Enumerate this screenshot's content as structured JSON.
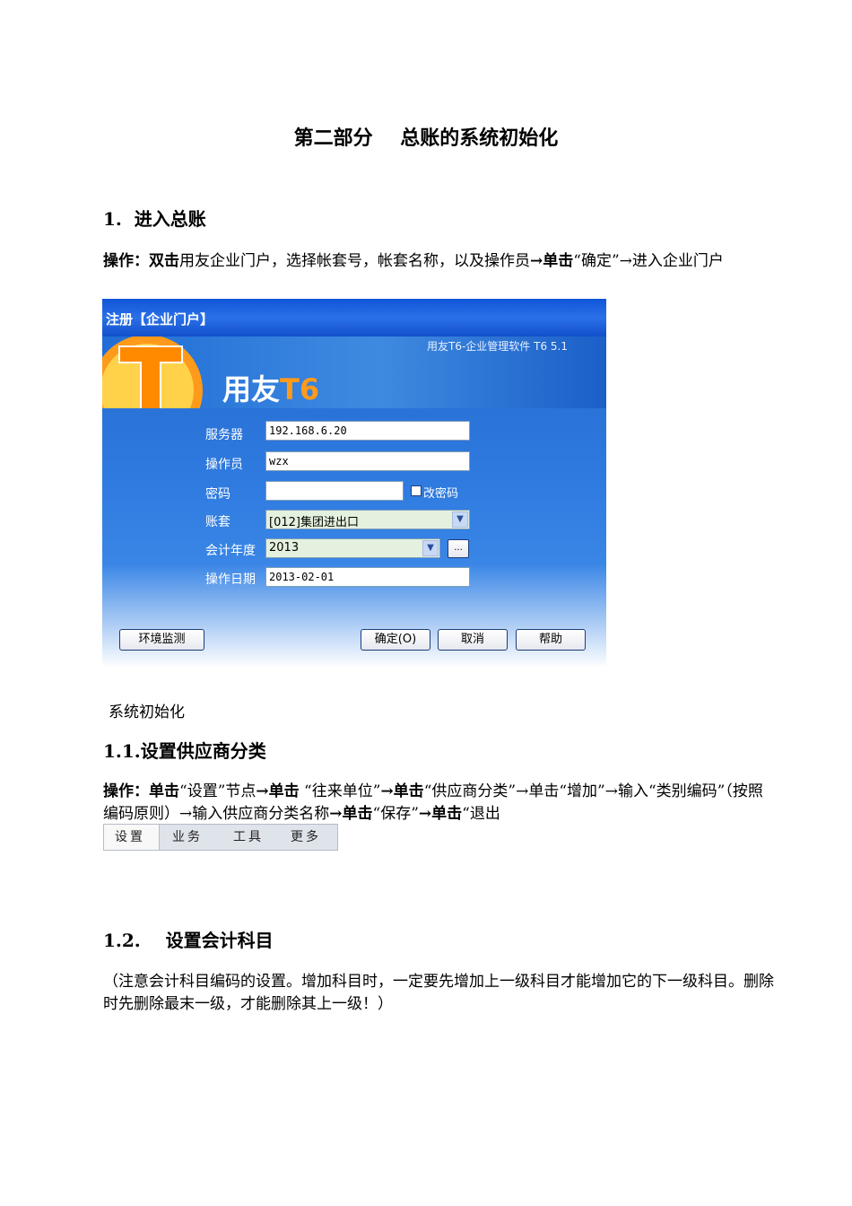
{
  "doc": {
    "title": "第二部分    总账的系统初始化",
    "s1_heading": "1.  进入总账",
    "s1_para": {
      "p1": "操作：",
      "p2": "双击",
      "p3": "用友企业门户，选择帐套号，帐套名称，以及操作员",
      "p4": "→",
      "p5": "单击",
      "p6": "“确定”→进入企业门户"
    },
    "caption": "系统初始化",
    "s11_heading": "1.1.设置供应商分类",
    "s11_para": {
      "p1": "操作：",
      "p2": "单击",
      "p3": "“设置”节点",
      "p4": "→单击",
      "p5": " “往来单位”",
      "p6": "→单击",
      "p7": "“供应商分类”→单击“增加”→输入“类别编码”（按照编码原则）→输入供应商分类名称",
      "p8": "→单击",
      "p9": "“保存”",
      "p10": "→单击",
      "p11": "“退出"
    },
    "s12_heading": "1.2.    设置会计科目",
    "s12_para": "（注意会计科目编码的设置。增加科目时，一定要先增加上一级科目才能增加它的下一级科目。删除时先删除最末一级，才能删除其上一级！）"
  },
  "dialog": {
    "window_title": "注册【企业门户】",
    "subtitle": "用友T6-企业管理软件 T6 5.1",
    "brand_main": "用友",
    "brand_t6": "T6",
    "server_label": "服务器",
    "server_value": "192.168.6.20",
    "operator_label": "操作员",
    "operator_value": "wzx",
    "password_label": "密码",
    "password_value": "",
    "change_pwd_label": "改密码",
    "account_label": "账套",
    "account_value": "[012]集团进出口",
    "year_label": "会计年度",
    "year_value": "2013",
    "more_label": "...",
    "date_label": "操作日期",
    "date_value": "2013-02-01",
    "env_btn": "环境监测",
    "ok_btn": "确定(O)",
    "cancel_btn": "取消",
    "help_btn": "帮助"
  },
  "menubar": {
    "items": [
      "设置",
      "业务",
      "工具",
      "更多"
    ]
  },
  "colors": {
    "dialog_blue": "#2b6fcf",
    "logo_orange": "#ff9a1a",
    "field_green": "#e4f1de"
  }
}
